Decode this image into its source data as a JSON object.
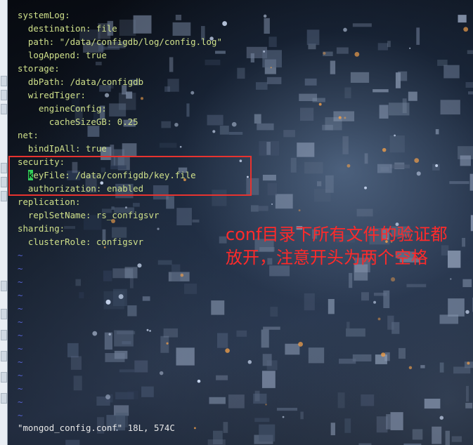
{
  "editor": {
    "lines": [
      {
        "text": "systemLog:"
      },
      {
        "text": "  destination: file"
      },
      {
        "text": "  path: \"/data/configdb/log/config.log\""
      },
      {
        "text": "  logAppend: true"
      },
      {
        "text": "storage:"
      },
      {
        "text": "  dbPath: /data/configdb"
      },
      {
        "text": "  wiredTiger:"
      },
      {
        "text": "    engineConfig:"
      },
      {
        "text": "      cacheSizeGB: 0.25"
      },
      {
        "text": "net:"
      },
      {
        "text": "  bindIpAll: true"
      },
      {
        "text": "security:"
      },
      {
        "text": "  keyFile: /data/configdb/key.file",
        "cursor_char": "k",
        "before": "  ",
        "after": "eyFile: /data/configdb/key.file"
      },
      {
        "text": "  authorization: enabled"
      },
      {
        "text": "replication:"
      },
      {
        "text": "  replSetName: rs_configsvr"
      },
      {
        "text": "sharding:"
      },
      {
        "text": "  clusterRole: configsvr"
      }
    ],
    "tilde_count": 13,
    "tilde_char": "~",
    "status_line": "\"mongod_config.conf\" 18L, 574C"
  },
  "annotation": {
    "note": "conf目录下所有文件的验证都放开，注意开头为两个空格"
  },
  "colors": {
    "text": "#cfe08a",
    "tilde": "#5561d0",
    "cursor": "#33d05a",
    "highlight_box": "#e8332f",
    "note": "#ff2a2a"
  }
}
